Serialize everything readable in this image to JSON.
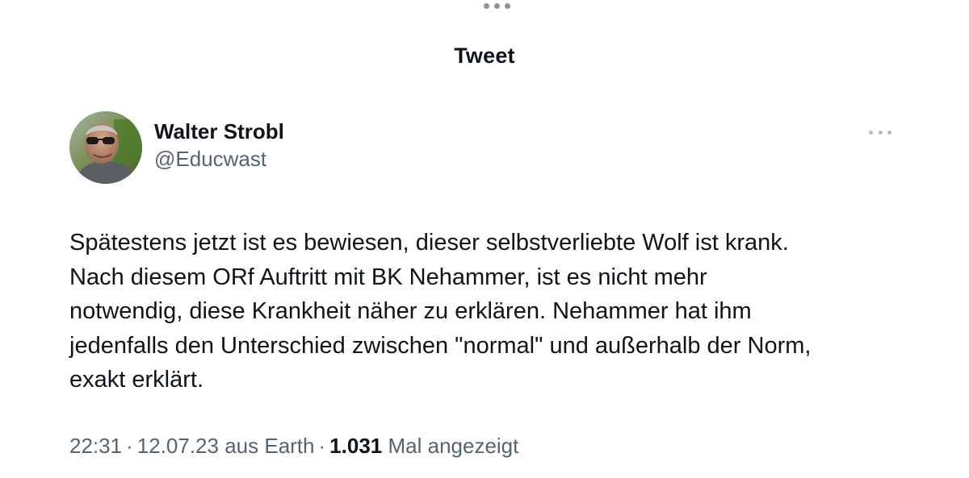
{
  "header": {
    "title": "Tweet"
  },
  "author": {
    "display_name": "Walter Strobl",
    "handle": "@Educwast",
    "avatar_icon": "user-photo-avatar"
  },
  "tweet": {
    "lines": [
      "Spätestens jetzt ist es bewiesen, dieser selbstverliebte Wolf ist krank.",
      "Nach diesem ORf Auftritt mit BK Nehammer, ist es nicht mehr",
      "notwendig, diese Krankheit näher zu erklären. Nehammer hat ihm",
      "jedenfalls den Unterschied zwischen \"normal\" und außerhalb der Norm,",
      "exakt erklärt."
    ]
  },
  "meta": {
    "time": "22:31",
    "date": "12.07.23",
    "source": "aus Earth",
    "separator": "·",
    "views_count": "1.031",
    "views_label": "Mal angezeigt"
  },
  "icons": {
    "top": "ellipsis-horizontal-icon",
    "more": "more-options-icon"
  },
  "colors": {
    "text_primary": "#0f1419",
    "text_secondary": "#536471",
    "background": "#ffffff"
  }
}
